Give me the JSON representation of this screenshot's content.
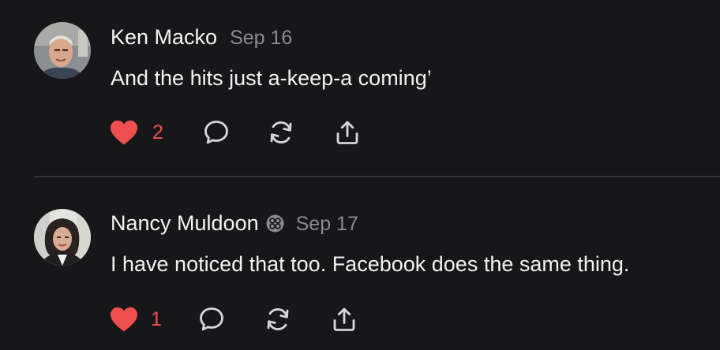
{
  "comments": [
    {
      "author": "Ken Macko",
      "date": "Sep 16",
      "text": "And the hits just a-keep-a coming’",
      "likes": "2",
      "liked": true,
      "verified": false
    },
    {
      "author": "Nancy Muldoon",
      "date": "Sep 17",
      "text": "I have noticed that too. Facebook does the same thing.",
      "likes": "1",
      "liked": true,
      "verified": true
    }
  ],
  "colors": {
    "background": "#17171a",
    "like_active": "#ef4f4f",
    "muted": "#8b8b8e",
    "icon": "#d6d6d8"
  }
}
